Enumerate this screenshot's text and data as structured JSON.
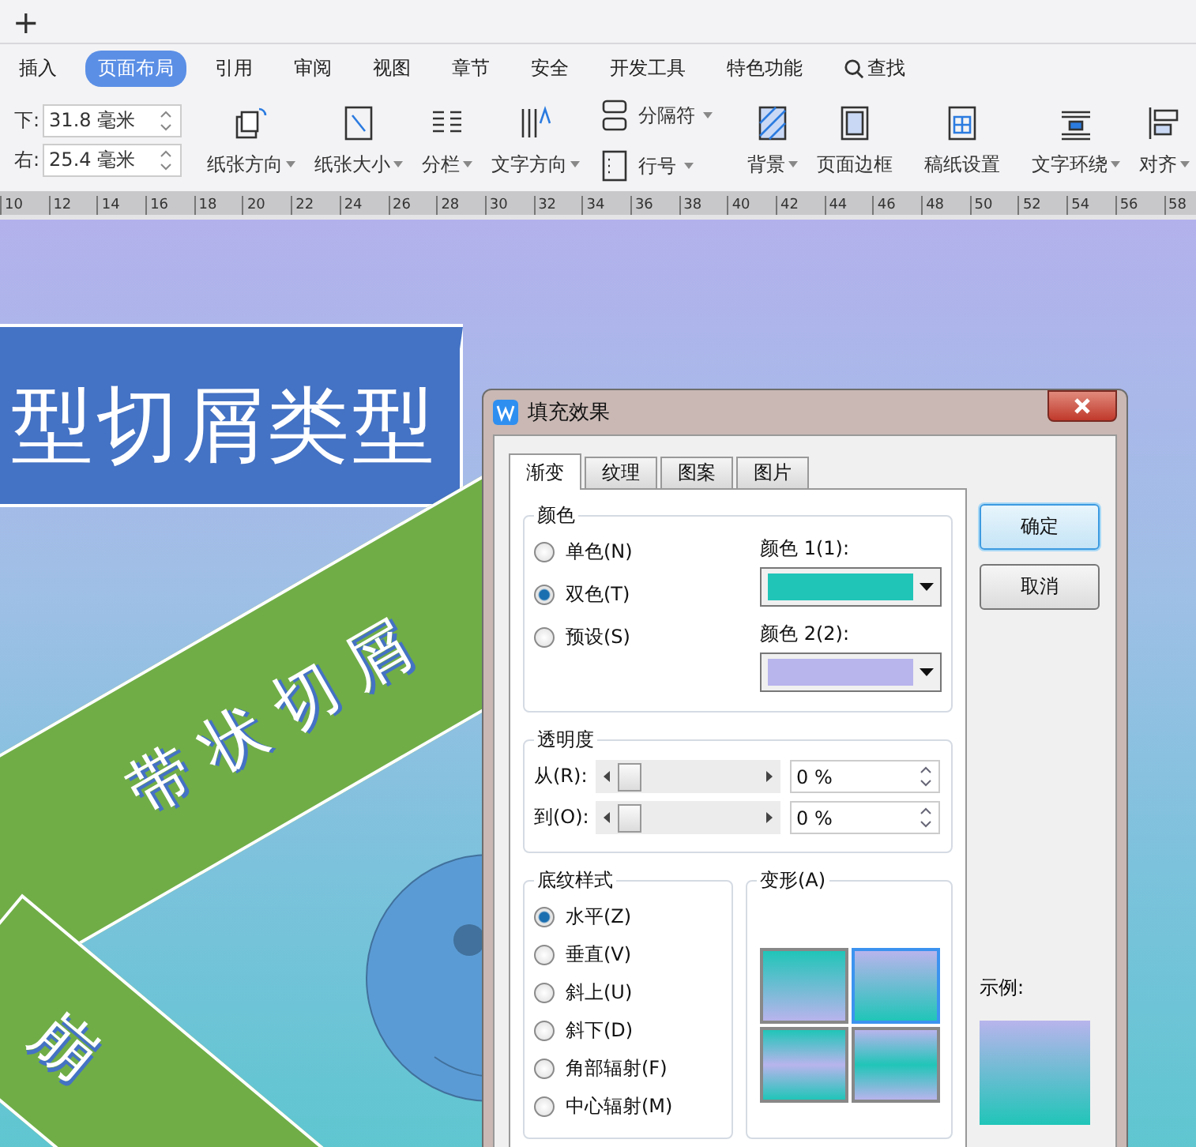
{
  "top_bar": {
    "new_tab": "+"
  },
  "menu_tabs": [
    {
      "label": "插入",
      "selected": false
    },
    {
      "label": "页面布局",
      "selected": true
    },
    {
      "label": "引用",
      "selected": false
    },
    {
      "label": "审阅",
      "selected": false
    },
    {
      "label": "视图",
      "selected": false
    },
    {
      "label": "章节",
      "selected": false
    },
    {
      "label": "安全",
      "selected": false
    },
    {
      "label": "开发工具",
      "selected": false
    },
    {
      "label": "特色功能",
      "selected": false
    },
    {
      "label": "查找",
      "selected": false
    }
  ],
  "margins": [
    {
      "label": "下:",
      "value": "31.8 毫米"
    },
    {
      "label": "右:",
      "value": "25.4 毫米"
    }
  ],
  "ribbon": [
    {
      "kind": "big",
      "label": "纸张方向",
      "dropdown": true
    },
    {
      "kind": "big",
      "label": "纸张大小",
      "dropdown": true
    },
    {
      "kind": "big",
      "label": "分栏",
      "dropdown": true
    },
    {
      "kind": "big",
      "label": "文字方向",
      "dropdown": true
    },
    {
      "kind": "small",
      "items": [
        {
          "label": "分隔符",
          "dropdown": true
        },
        {
          "label": "行号",
          "dropdown": true
        }
      ]
    },
    {
      "kind": "sep"
    },
    {
      "kind": "big",
      "label": "背景",
      "dropdown": true
    },
    {
      "kind": "big",
      "label": "页面边框",
      "dropdown": false
    },
    {
      "kind": "sep"
    },
    {
      "kind": "big",
      "label": "稿纸设置",
      "dropdown": false
    },
    {
      "kind": "sep"
    },
    {
      "kind": "big",
      "label": "文字环绕",
      "dropdown": true
    },
    {
      "kind": "big",
      "label": "对齐",
      "dropdown": true
    }
  ],
  "ruler": [
    "10",
    "12",
    "14",
    "16",
    "18",
    "20",
    "22",
    "24",
    "26",
    "28",
    "30",
    "32",
    "34",
    "36",
    "38",
    "40",
    "42",
    "44",
    "46",
    "48",
    "50",
    "52",
    "54",
    "56",
    "58"
  ],
  "document": {
    "title": "型切屑类型",
    "bands": [
      "带 状 切 屑",
      "崩"
    ]
  },
  "dialog": {
    "title": "填充效果",
    "tabs": [
      {
        "label": "渐变",
        "selected": true
      },
      {
        "label": "纹理",
        "selected": false
      },
      {
        "label": "图案",
        "selected": false
      },
      {
        "label": "图片",
        "selected": false
      }
    ],
    "buttons": [
      {
        "label": "确定",
        "default": true
      },
      {
        "label": "取消",
        "default": false
      }
    ],
    "color_group": {
      "title": "颜色",
      "options": [
        {
          "label": "单色(N)",
          "selected": false
        },
        {
          "label": "双色(T)",
          "selected": true
        },
        {
          "label": "预设(S)",
          "selected": false
        }
      ],
      "swatches": [
        {
          "label": "颜色 1(1):",
          "color": "#20c5b8"
        },
        {
          "label": "颜色 2(2):",
          "color": "#b8b4ec"
        }
      ]
    },
    "transparency": {
      "title": "透明度",
      "rows": [
        {
          "label": "从(R):",
          "level": 0.1,
          "value": "0 %"
        },
        {
          "label": "到(O):",
          "level": 0.1,
          "value": "0 %"
        }
      ]
    },
    "shading": {
      "title": "底纹样式",
      "options": [
        {
          "label": "水平(Z)",
          "selected": true
        },
        {
          "label": "垂直(V)",
          "selected": false
        },
        {
          "label": "斜上(U)",
          "selected": false
        },
        {
          "label": "斜下(D)",
          "selected": false
        },
        {
          "label": "角部辐射(F)",
          "selected": false
        },
        {
          "label": "中心辐射(M)",
          "selected": false
        }
      ]
    },
    "variants": {
      "title": "变形(A)",
      "items": [
        {
          "selected": false
        },
        {
          "selected": true
        },
        {
          "selected": false
        },
        {
          "selected": false
        }
      ]
    },
    "sample": {
      "label": "示例:"
    }
  }
}
